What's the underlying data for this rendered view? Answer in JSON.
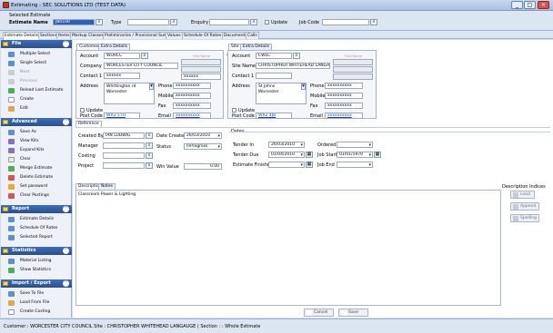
{
  "window": {
    "title": "Estimating : SEC SOLUTIONS LTD (TEST DATA)",
    "minimize": "_",
    "maximize": "□",
    "close": "✕"
  },
  "selection": {
    "selected_label": "Selected Estimate",
    "name_label": "Estimate Name",
    "name_value": "JB0100",
    "type_label": "Type",
    "type_value": "",
    "enquiry_label": "Enquiry",
    "enquiry_value": "",
    "update_label": "Update",
    "jobcode_label": "Job Code",
    "jobcode_value": ""
  },
  "tabs": [
    "Estimate Details",
    "Sections",
    "Items",
    "Markup Classes",
    "Preliminaries / Provisional Sums",
    "Values",
    "Schedule Of Rates",
    "Documents",
    "Calls"
  ],
  "sidebar": {
    "groups": [
      {
        "title": "File",
        "items": [
          {
            "label": "Multiple Select"
          },
          {
            "label": "Single Select"
          },
          {
            "label": "Next"
          },
          {
            "label": "Previous"
          },
          {
            "label": "Reload Last Estimate"
          },
          {
            "label": "Create"
          },
          {
            "label": "Edit"
          }
        ]
      },
      {
        "title": "Advanced",
        "items": [
          {
            "label": "Save As"
          },
          {
            "label": "View Kits"
          },
          {
            "label": "Expand Kits"
          },
          {
            "label": "Clear"
          },
          {
            "label": "Merge Estimate"
          },
          {
            "label": "Delete Estimate"
          },
          {
            "label": "Set password"
          },
          {
            "label": "Clear Postings"
          }
        ]
      },
      {
        "title": "Report",
        "items": [
          {
            "label": "Estimate Details"
          },
          {
            "label": "Schedule Of Rates"
          },
          {
            "label": "Selected Report"
          }
        ]
      },
      {
        "title": "Statistics",
        "items": [
          {
            "label": "Material Listing"
          },
          {
            "label": "Show Statistics"
          }
        ]
      },
      {
        "title": "Import / Export",
        "items": [
          {
            "label": "Save To File"
          },
          {
            "label": "Load From File"
          },
          {
            "label": "Create Costing"
          }
        ]
      }
    ]
  },
  "customer": {
    "tabs": [
      "Customer",
      "Extra Details"
    ],
    "account_label": "Account",
    "account": "WORCC",
    "find_name": "Find Name",
    "company_label": "Company",
    "company": "WORCESTER CITY COUNCIL",
    "contact_label": "Contact 1",
    "contact": "xxxxxx",
    "address_label": "Address",
    "address": "Whittington rd\nWorcester",
    "update_label": "Update",
    "phone_label": "Phone",
    "phone": "xxxxxxxxxx",
    "mobile_label": "Mobile",
    "mobile": "xxxxxxxxxx",
    "fax_label": "Fax",
    "fax": "xxxxxxxxxx",
    "postcode_label": "Post Code",
    "postcode": "WR3 5TH",
    "email_label": "Email",
    "email": "xxxxxxxxxx"
  },
  "site": {
    "tabs": [
      "Site",
      "Extra Details"
    ],
    "account_label": "Account",
    "account": "CWLC",
    "find_name": "Find Name",
    "sitename_label": "Site Name",
    "sitename": "CHRISTOPHER WHITEHEAD LANGAUGE",
    "contact_label": "Contact 1",
    "contact": "",
    "address_label": "Address",
    "address": "St Johns\nWorcester",
    "update_label": "Update",
    "phone_label": "Phone",
    "phone": "xxxxxxxxxx",
    "mobile_label": "Mobile",
    "mobile": "xxxxxxxxxx",
    "fax_label": "Fax",
    "fax": "xxxxxxxxxx",
    "postcode_label": "Post Code",
    "postcode": "WR2 4JB",
    "email_label": "Email",
    "email": "xxxxxxxxxx"
  },
  "reference": {
    "tab": "Reference",
    "created_by_label": "Created By",
    "created_by": "IAN LUDWIG",
    "manager_label": "Manager",
    "manager": "",
    "costing_label": "Costing",
    "costing": "",
    "project_label": "Project",
    "project": "",
    "date_created_label": "Date Created",
    "date_created": "26/03/2010",
    "status_label": "Status",
    "status": "InProgress",
    "win_value_label": "Win Value",
    "win_value": "0.00"
  },
  "dates": {
    "title": "Dates",
    "tender_in_label": "Tender In",
    "tender_in": "26/03/2010",
    "tender_due_label": "Tender Due",
    "tender_due": "01/04/2010",
    "finished_label": "Estimate Finished",
    "finished": "",
    "ordered_label": "Ordered",
    "ordered": "",
    "job_start_label": "Job Start",
    "job_start": "01/01/1970",
    "job_end_label": "Job End",
    "job_end": ""
  },
  "description": {
    "tabs": [
      "Description",
      "Notes"
    ],
    "text": "Classroom Power & Lighting",
    "indices_label": "Description Indices",
    "load": "Load",
    "append": "Append",
    "spelling": "Spelling"
  },
  "actions": {
    "cancel": "Cancel",
    "save": "Save"
  },
  "status_bar": "Customer : WORCESTER CITY COUNCIL          Site : CHRISTOPHER WHITEHEAD LANGAUGE ( Section : : Whole Estimate"
}
